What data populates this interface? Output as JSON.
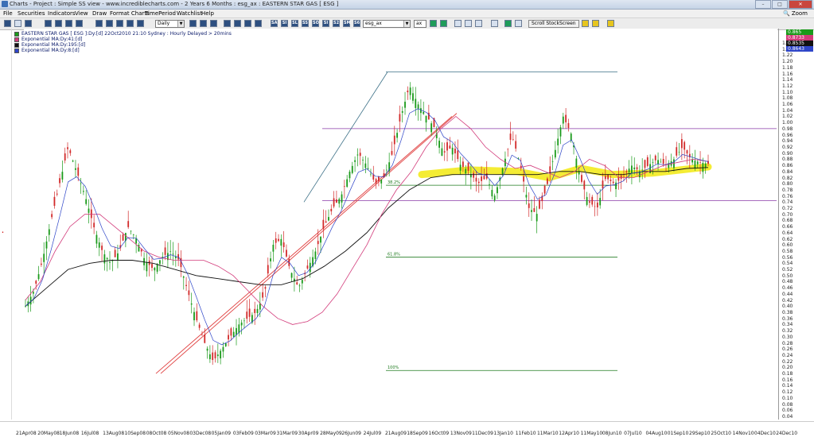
{
  "window": {
    "title": "Charts - Project : Simple SS view - www.incrediblecharts.com - 2 Years 6 Months : esg_ax : EASTERN STAR GAS  [ ESG ]",
    "minimize": "–",
    "maximize": "□",
    "close": "✕"
  },
  "menu": {
    "items": [
      "File",
      "Securities",
      "Indicators",
      "View",
      "Draw",
      "Format Charts",
      "TimePeriod",
      "Watchlist",
      "Help"
    ],
    "zoom_label": "Zoom"
  },
  "toolbar": {
    "period_select": "Daily",
    "symbol_input": "esg_ax",
    "exchange_select": "ax",
    "scroll_button": "Scroll StockScreen",
    "tool_labels": [
      "SA",
      "SI",
      "SL",
      "SS",
      "SO",
      "SI",
      "S2",
      "SM",
      "S6"
    ]
  },
  "nav": {
    "first": "|◀",
    "prev": "◀",
    "next": "▶",
    "last": "▶|"
  },
  "legend": [
    {
      "label": "EASTERN STAR GAS [ ESG ]:Dy:[d]  22Oct2010 21:10 Sydney : Hourly Delayed > 20mins",
      "color": "#1a9a1a"
    },
    {
      "label": "Exponential MA:Dy:41:[d]",
      "color": "#d23a7a"
    },
    {
      "label": "Exponential MA:Dy:195:[d]",
      "color": "#111111"
    },
    {
      "label": "Exponential MA:Dy:8:[d]",
      "color": "#2e45c8"
    }
  ],
  "price_boxes": [
    {
      "value": "0.865",
      "color": "#1a9a1a"
    },
    {
      "value": "0.8733",
      "color": "#d23a7a"
    },
    {
      "value": "0.8535",
      "color": "#111111"
    },
    {
      "value": "0.8643",
      "color": "#2e45c8"
    }
  ],
  "chart_data": {
    "type": "candlestick",
    "title": "",
    "y_min": 0.04,
    "y_max": 1.26,
    "y_ticks": [
      "1.26",
      "1.24",
      "1.22",
      "1.20",
      "1.18",
      "1.16",
      "1.14",
      "1.12",
      "1.10",
      "1.08",
      "1.06",
      "1.04",
      "1.02",
      "1.00",
      "0.98",
      "0.96",
      "0.94",
      "0.92",
      "0.90",
      "0.88",
      "0.86",
      "0.84",
      "0.82",
      "0.80",
      "0.78",
      "0.76",
      "0.74",
      "0.72",
      "0.70",
      "0.68",
      "0.66",
      "0.64",
      "0.62",
      "0.60",
      "0.58",
      "0.56",
      "0.54",
      "0.52",
      "0.50",
      "0.48",
      "0.46",
      "0.44",
      "0.42",
      "0.40",
      "0.38",
      "0.36",
      "0.34",
      "0.32",
      "0.30",
      "0.28",
      "0.26",
      "0.24",
      "0.22",
      "0.20",
      "0.18",
      "0.16",
      "0.14",
      "0.12",
      "0.10",
      "0.08",
      "0.06",
      "0.04"
    ],
    "x_ticks": [
      "21Apr08",
      "20May08",
      "18Jun08",
      "16Jul08",
      "13Aug08",
      "10Sep08",
      "08Oct08",
      "05Nov08",
      "03Dec08",
      "05Jan09",
      "03Feb09",
      "03Mar09",
      "31Mar09",
      "30Apr09",
      "28May09",
      "26Jun09",
      "24Jul09",
      "21Aug09",
      "18Sep09",
      "16Oct09",
      "13Nov09",
      "11Dec09",
      "13Jan10",
      "11Feb10",
      "11Mar10",
      "12Apr10",
      "11May10",
      "08Jun10",
      "07Jul10",
      "04Aug10",
      "01Sep10",
      "29Sep10",
      "25Oct10",
      "14Nov10",
      "04Dec10",
      "24Dec10"
    ],
    "close_series": [
      0.4,
      0.45,
      0.55,
      0.68,
      0.8,
      0.92,
      0.84,
      0.76,
      0.66,
      0.58,
      0.54,
      0.58,
      0.66,
      0.62,
      0.55,
      0.52,
      0.56,
      0.58,
      0.55,
      0.45,
      0.36,
      0.28,
      0.22,
      0.26,
      0.3,
      0.34,
      0.36,
      0.38,
      0.44,
      0.6,
      0.62,
      0.52,
      0.46,
      0.52,
      0.58,
      0.66,
      0.72,
      0.76,
      0.84,
      0.9,
      0.86,
      0.8,
      0.82,
      0.9,
      1.02,
      1.12,
      1.06,
      1.02,
      0.98,
      0.9,
      0.92,
      0.86,
      0.84,
      0.8,
      0.82,
      0.76,
      0.86,
      0.96,
      0.86,
      0.72,
      0.7,
      0.78,
      0.9,
      1.02,
      0.96,
      0.82,
      0.74,
      0.72,
      0.82,
      0.8,
      0.82,
      0.86,
      0.84,
      0.86,
      0.88,
      0.86,
      0.88,
      0.92,
      0.88,
      0.87,
      0.865
    ],
    "ema41": [
      0.42,
      0.48,
      0.58,
      0.66,
      0.7,
      0.7,
      0.66,
      0.62,
      0.58,
      0.56,
      0.55,
      0.55,
      0.55,
      0.53,
      0.5,
      0.45,
      0.4,
      0.36,
      0.34,
      0.35,
      0.38,
      0.44,
      0.52,
      0.6,
      0.7,
      0.78,
      0.84,
      0.92,
      0.98,
      1.02,
      0.98,
      0.92,
      0.88,
      0.85,
      0.86,
      0.84,
      0.82,
      0.84,
      0.88,
      0.86,
      0.82,
      0.82,
      0.84,
      0.86,
      0.87,
      0.88,
      0.873
    ],
    "ema195": [
      0.4,
      0.46,
      0.52,
      0.54,
      0.55,
      0.55,
      0.54,
      0.52,
      0.5,
      0.49,
      0.48,
      0.47,
      0.47,
      0.49,
      0.53,
      0.58,
      0.64,
      0.72,
      0.78,
      0.82,
      0.83,
      0.83,
      0.83,
      0.83,
      0.83,
      0.84,
      0.84,
      0.83,
      0.83,
      0.84,
      0.84,
      0.85,
      0.853
    ],
    "fib_levels": [
      {
        "label": "38.2%",
        "value": 0.795
      },
      {
        "label": "61.8%",
        "value": 0.56
      },
      {
        "label": "100%",
        "value": 0.19
      }
    ],
    "horizontal_lines": [
      1.165,
      0.98,
      0.745
    ],
    "grid": false
  }
}
